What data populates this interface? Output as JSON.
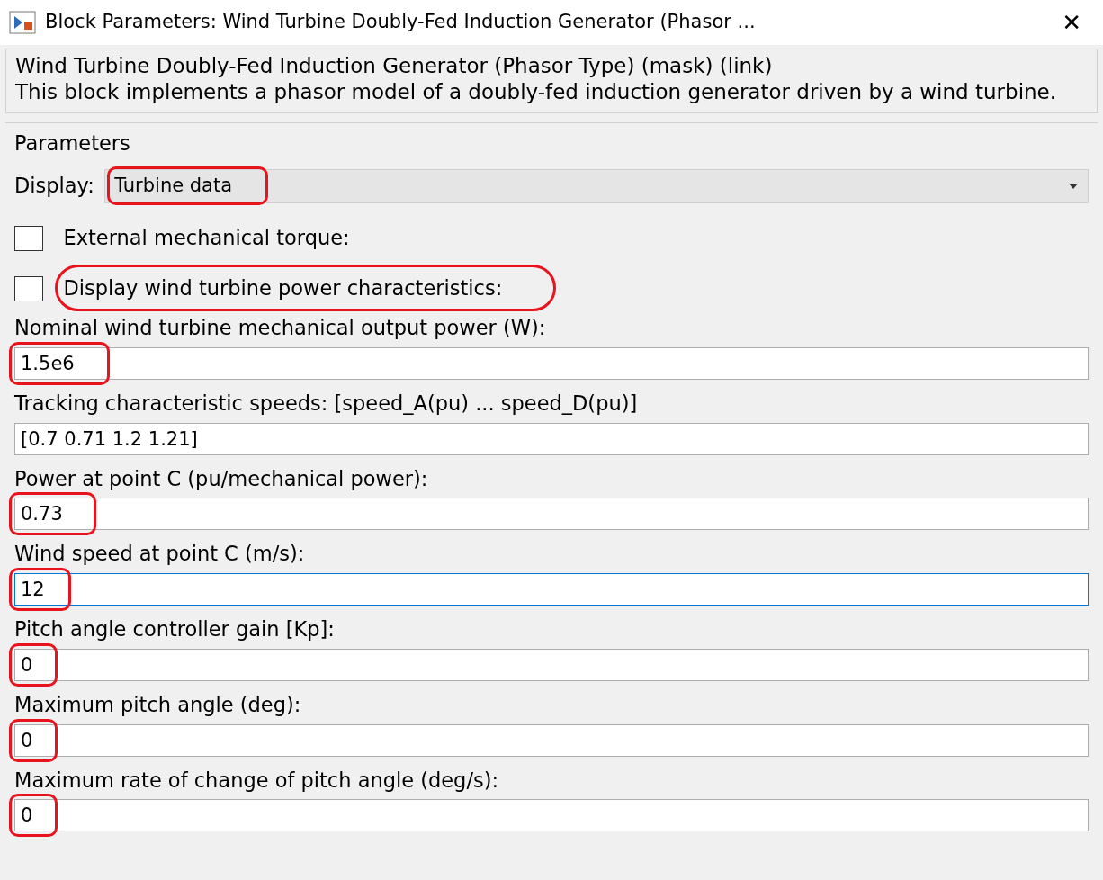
{
  "window": {
    "title": "Block Parameters: Wind Turbine Doubly-Fed Induction Generator (Phasor ...",
    "close": "✕"
  },
  "description": {
    "heading": "Wind Turbine Doubly-Fed Induction Generator (Phasor Type) (mask) (link)",
    "text": "This block implements a phasor model of a doubly-fed induction generator driven by a wind turbine."
  },
  "parameters": {
    "legend": "Parameters",
    "display": {
      "label": "Display:",
      "value": "Turbine data",
      "highlighted": true
    },
    "checkboxes": [
      {
        "label": "External mechanical torque:",
        "checked": false,
        "highlighted": false
      },
      {
        "label": "Display wind turbine power characteristics:",
        "checked": false,
        "highlighted": true
      }
    ],
    "fields": [
      {
        "label": "Nominal wind turbine mechanical output power (W):",
        "value": "1.5e6",
        "highlighted": true,
        "focused": false
      },
      {
        "label": "Tracking characteristic speeds: [speed_A(pu) ... speed_D(pu)]",
        "value": "[0.7 0.71 1.2 1.21]",
        "highlighted": false,
        "focused": false
      },
      {
        "label": "Power at point C (pu/mechanical power):",
        "value": "0.73",
        "highlighted": true,
        "focused": false
      },
      {
        "label": "Wind speed at point C (m/s):",
        "value": "12",
        "highlighted": true,
        "focused": true
      },
      {
        "label": "Pitch angle controller gain [Kp]:",
        "value": "0",
        "highlighted": true,
        "focused": false
      },
      {
        "label": "Maximum pitch angle (deg):",
        "value": "0",
        "highlighted": true,
        "focused": false
      },
      {
        "label": "Maximum rate of change of pitch angle (deg/s):",
        "value": "0",
        "highlighted": true,
        "focused": false
      }
    ]
  }
}
